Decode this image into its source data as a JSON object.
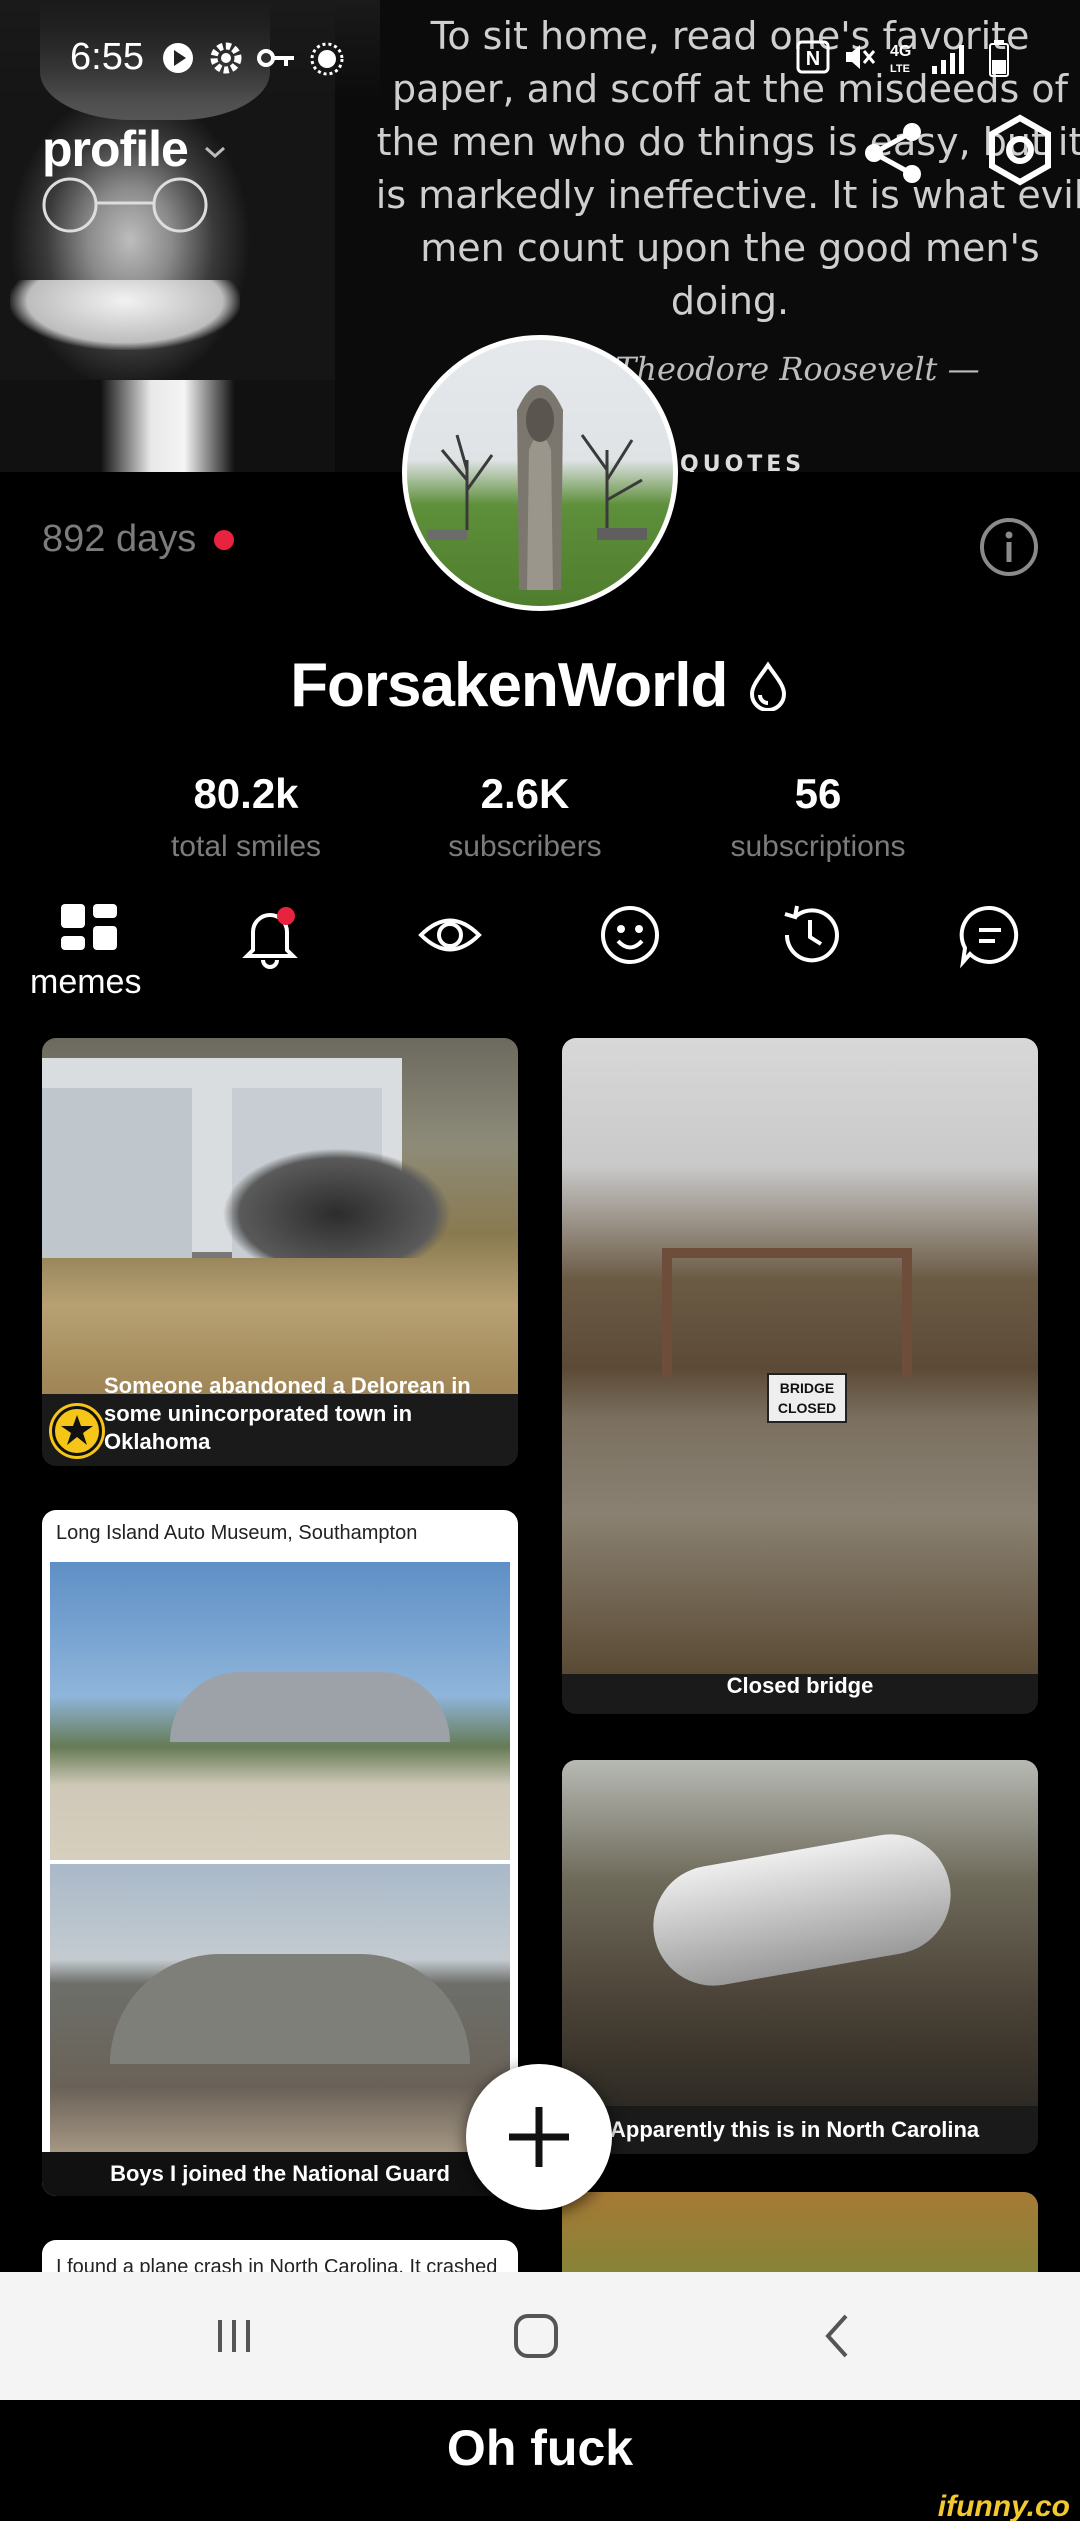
{
  "status_bar": {
    "time": "6:55",
    "icons": [
      "media-play-icon",
      "gear-icon",
      "key-icon",
      "sun-icon",
      "nfc-icon",
      "mute-icon",
      "4g-lte-icon",
      "signal-icon",
      "battery-icon"
    ]
  },
  "cover": {
    "quote": "To sit home, read one's favorite paper, and scoff at the misdeeds of the men who do things is easy, but it is markedly ineffective. It is what evil men count upon the good men's doing.",
    "author": "Theodore Roosevelt —",
    "brand": "QUOTES"
  },
  "header": {
    "title": "profile",
    "share_icon": "share-icon",
    "settings_icon": "settings-hex-icon"
  },
  "account": {
    "days": "892 days",
    "username": "ForsakenWorld",
    "badge_icon": "droplet-icon",
    "accent_color": "#e8233d"
  },
  "stats": [
    {
      "value": "80.2k",
      "label": "total smiles"
    },
    {
      "value": "2.6K",
      "label": "subscribers"
    },
    {
      "value": "56",
      "label": "subscriptions"
    }
  ],
  "tabs": {
    "active_label": "memes",
    "icons": [
      "grid-icon",
      "bell-icon",
      "eye-icon",
      "smile-icon",
      "history-icon",
      "comment-icon"
    ]
  },
  "feed": {
    "delorean_caption": "Someone abandoned a Delorean in some unincorporated town in Oklahoma",
    "museum_title": "Long Island Auto Museum, Southampton",
    "museum_caption": "Boys I joined the National Guard",
    "plane_left_title": "I found a plane crash in North Carolina. It crashed",
    "bridge_sign": "BRIDGE CLOSED",
    "bridge_caption": "Closed bridge",
    "plane_caption": "Apparently this is in North Carolina"
  },
  "meme_caption": "Oh fuck",
  "watermark": "ifunny.co"
}
